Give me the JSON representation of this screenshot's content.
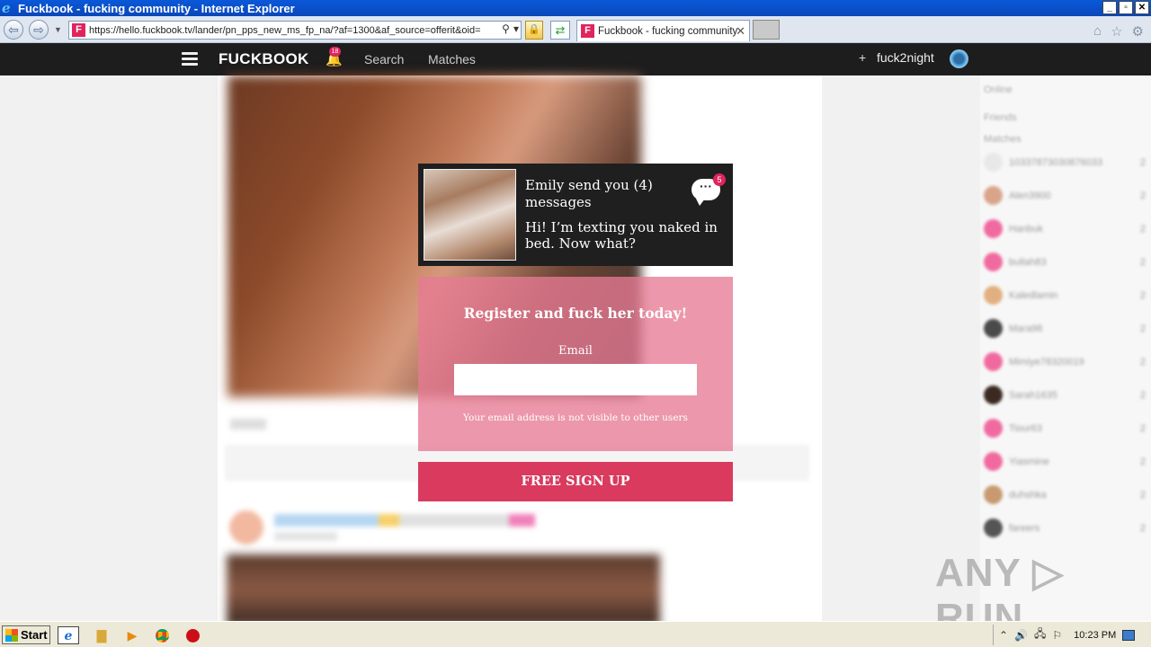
{
  "browser": {
    "window_title": "Fuckbook - fucking community - Internet Explorer",
    "window_controls": [
      "_",
      "▫",
      "✕"
    ],
    "url": "https://hello.fuckbook.tv/lander/pn_pps_new_ms_fp_na/?af=1300&af_source=offerit&oid=",
    "tab_label": "Fuckbook - fucking community",
    "tab_favicon": "F"
  },
  "site": {
    "logo": "FUCKBOOK",
    "notification_count": "18",
    "nav": {
      "search": "Search",
      "matches": "Matches"
    },
    "user_plus": "+",
    "username": "fuck2night"
  },
  "sidebar": {
    "online_label": "Online",
    "friends_label": "Friends",
    "matches_label": "Matches",
    "users": [
      {
        "name": "10337873030876033",
        "count": "2",
        "color": "#e8e8e8"
      },
      {
        "name": "Alen3900",
        "count": "2",
        "color": "#d9a58a"
      },
      {
        "name": "Hanbuk",
        "count": "2",
        "color": "#f06aa0"
      },
      {
        "name": "bullah83",
        "count": "2",
        "color": "#f06aa0"
      },
      {
        "name": "Kaledlamin",
        "count": "2",
        "color": "#e0b080"
      },
      {
        "name": "Mara98",
        "count": "2",
        "color": "#4a4a4a"
      },
      {
        "name": "Mimiye78320019",
        "count": "2",
        "color": "#f06aa0"
      },
      {
        "name": "Sarah1635",
        "count": "2",
        "color": "#3a2a22"
      },
      {
        "name": "Tiour63",
        "count": "2",
        "color": "#f06aa0"
      },
      {
        "name": "Yiasmine",
        "count": "2",
        "color": "#f06aa0"
      },
      {
        "name": "duhshka",
        "count": "2",
        "color": "#c79a70"
      },
      {
        "name": "fareers",
        "count": "2",
        "color": "#555"
      }
    ]
  },
  "message_card": {
    "title": "Emily send you (4) messages",
    "text": "Hi! I’m texting you naked in bed. Now what?",
    "chat_icon": "···",
    "unread_count": "5"
  },
  "register": {
    "title": "Register and fuck her today!",
    "email_label": "Email",
    "email_value": "",
    "email_note": "Your email address is not visible to other users",
    "signup_label": "FREE SIGN UP"
  },
  "watermark": "ANY ▷ RUN",
  "taskbar": {
    "start_label": "Start",
    "clock": "10:23 PM"
  }
}
